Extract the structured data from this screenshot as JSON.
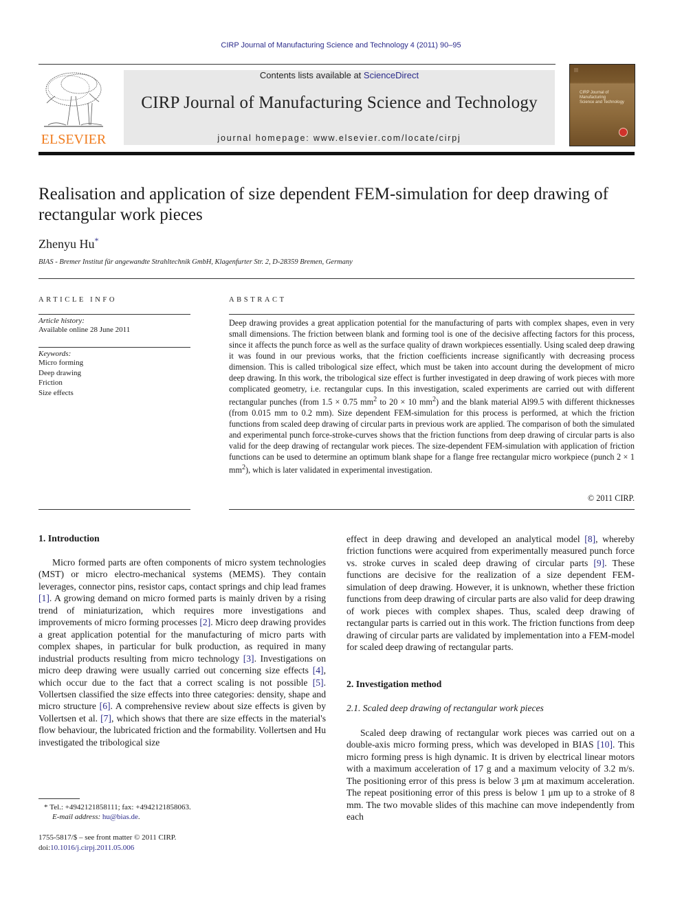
{
  "running_head": "CIRP Journal of Manufacturing Science and Technology 4 (2011) 90–95",
  "masthead": {
    "publisher": "ELSEVIER",
    "contents_prefix": "Contents lists available at ",
    "contents_link": "ScienceDirect",
    "journal_title": "CIRP Journal of Manufacturing Science and Technology",
    "homepage": "journal homepage: www.elsevier.com/locate/cirpj",
    "cover_text": [
      "CIRP Journal of",
      "Manufacturing",
      "Science and Technology"
    ],
    "colors": {
      "publisher_orange": "#f07c1e",
      "link_blue": "#2a2a8a",
      "cover_brown": "#7c5a2e"
    }
  },
  "article": {
    "title": "Realisation and application of size dependent FEM-simulation for deep drawing of rectangular work pieces",
    "author": "Zhenyu Hu",
    "author_mark": "*",
    "affiliation": "BIAS - Bremer Institut für angewandte Strahltechnik GmbH, Klagenfurter Str. 2, D-28359 Bremen, Germany"
  },
  "article_info": {
    "heading": "ARTICLE INFO",
    "history_label": "Article history:",
    "history_value": "Available online 28 June 2011",
    "keywords_label": "Keywords:",
    "keywords": [
      "Micro forming",
      "Deep drawing",
      "Friction",
      "Size effects"
    ]
  },
  "abstract": {
    "heading": "ABSTRACT",
    "text_1": "Deep drawing provides a great application potential for the manufacturing of parts with complex shapes, even in very small dimensions. The friction between blank and forming tool is one of the decisive affecting factors for this process, since it affects the punch force as well as the surface quality of drawn workpieces essentially. Using scaled deep drawing it was found in our previous works, that the friction coefficients increase significantly with decreasing process dimension. This is called tribological size effect, which must be taken into account during the development of micro deep drawing. In this work, the tribological size effect is further investigated in deep drawing of work pieces with more complicated geometry, i.e. rectangular cups. In this investigation, scaled experiments are carried out with different rectangular punches (from 1.5 × 0.75 mm",
    "sup_1": "2",
    "text_2": " to 20 × 10 mm",
    "sup_2": "2",
    "text_3": ") and the blank material Al99.5 with different thicknesses (from 0.015 mm to 0.2 mm). Size dependent FEM-simulation for this process is performed, at which the friction functions from scaled deep drawing of circular parts in previous work are applied. The comparison of both the simulated and experimental punch force-stroke-curves shows that the friction functions from deep drawing of circular parts is also valid for the deep drawing of rectangular work pieces. The size-dependent FEM-simulation with application of friction functions can be used to determine an optimum blank shape for a flange free rectangular micro workpiece (punch 2 × 1 mm",
    "sup_3": "2",
    "text_4": "), which is later validated in experimental investigation.",
    "copyright": "© 2011 CIRP."
  },
  "body": {
    "section1_heading": "1.  Introduction",
    "intro": {
      "t1": "Micro formed parts are often components of micro system technologies (MST) or micro electro-mechanical systems (MEMS). They contain leverages, connector pins, resistor caps, contact springs and chip lead frames ",
      "r1": "[1]",
      "t2": ". A growing demand on micro formed parts is mainly driven by a rising trend of miniaturization, which requires more investigations and improvements of micro forming processes ",
      "r2": "[2]",
      "t3": ". Micro deep drawing provides a great application potential for the manufacturing of micro parts with complex shapes, in particular for bulk production, as required in many industrial products resulting from micro technology ",
      "r3": "[3]",
      "t4": ". Investigations on micro deep drawing were usually carried out concerning size effects ",
      "r4": "[4]",
      "t5": ", which occur due to the fact that a correct scaling is not possible ",
      "r5": "[5]",
      "t6": ". Vollertsen classified the size effects into three categories: density, shape and micro structure ",
      "r6": "[6]",
      "t7": ". A comprehensive review about size effects is given by Vollertsen et al. ",
      "r7": "[7]",
      "t8": ", which shows that there are size effects in the material's flow behaviour, the lubricated friction and the formability. Vollertsen and Hu investigated the tribological size effect in deep drawing and developed an analytical model ",
      "r8": "[8]",
      "t9": ", whereby friction functions were acquired from experimentally measured punch force vs. stroke curves in scaled deep drawing of circular parts ",
      "r9": "[9]",
      "t10": ". These functions are decisive for the realization of a size dependent FEM-simulation of deep drawing. However, it is unknown, whether these friction functions from deep drawing of circular parts are also valid for deep drawing of work pieces with complex shapes. Thus, scaled deep drawing of rectangular parts is carried out in this work. The friction functions from deep drawing of circular parts are validated by implementation into a FEM-model for scaled deep drawing of rectangular parts."
    },
    "section2_heading": "2.  Investigation method",
    "subsection21_heading": "2.1.  Scaled deep drawing of rectangular work pieces",
    "method": {
      "t1": "Scaled deep drawing of rectangular work pieces was carried out on a double-axis micro forming press, which was developed in BIAS ",
      "r10": "[10]",
      "t2": ". This micro forming press is high dynamic. It is driven by electrical linear motors with a maximum acceleration of 17 g and a maximum velocity of 3.2 m/s. The positioning error of this press is below 3 μm at maximum acceleration. The repeat positioning error of this press is below 1 μm up to a stroke of 8 mm. The two movable slides of this machine can move independently from each"
    }
  },
  "footnotes": {
    "mark": "*",
    "contact": "Tel.: +4942121858111; fax: +4942121858063.",
    "email_label": "E-mail address: ",
    "email": "hu@bias.de",
    "email_suffix": ".",
    "issn": "1755-5817/$ – see front matter © 2011 CIRP.",
    "doi_label": "doi:",
    "doi": "10.1016/j.cirpj.2011.05.006"
  }
}
